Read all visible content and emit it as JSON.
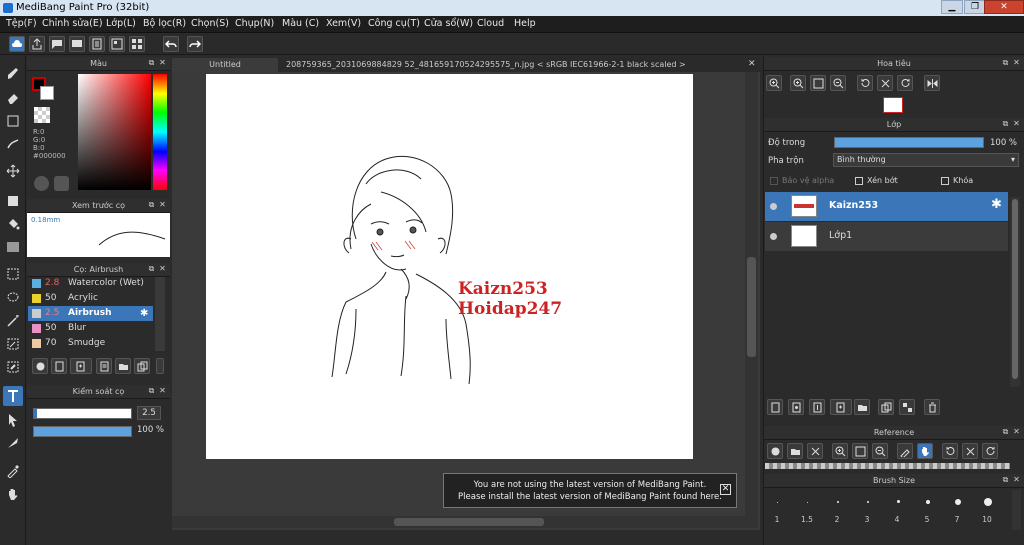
{
  "window": {
    "title": "MediBang Paint Pro (32bit)",
    "min": "▁",
    "max": "❐",
    "close": "✕"
  },
  "menu": [
    "Tệp(F)",
    "Chỉnh sửa(E)",
    "Lớp(L)",
    "Bộ lọc(R)",
    "Chọn(S)",
    "Chụp(N)",
    "Màu (C)",
    "Xem(V)",
    "Công cụ(T)",
    "Cửa sổ(W)",
    "Cloud",
    "Help"
  ],
  "color_panel": {
    "title": "Màu",
    "r": "R:0",
    "g": "G:0",
    "b": "B:0",
    "hex": "#000000"
  },
  "preview_panel": {
    "title": "Xem trước cọ",
    "size": "0.18mm"
  },
  "brush_panel": {
    "title": "Cọ: Airbrush",
    "items": [
      {
        "size": "2.8",
        "name": "Watercolor (Wet)",
        "color": "#5ab0e0"
      },
      {
        "size": "50",
        "name": "Acrylic",
        "color": "#e8d030"
      },
      {
        "size": "2.5",
        "name": "Airbrush",
        "color": "#cccccc"
      },
      {
        "size": "50",
        "name": "Blur",
        "color": "#e890c8"
      },
      {
        "size": "70",
        "name": "Smudge",
        "color": "#f0c8a0"
      }
    ]
  },
  "brush_control": {
    "title": "Kiểm soát cọ",
    "size": "2.5",
    "opacity": "100 %"
  },
  "tabs": [
    "Untitled",
    "208759365_2031069884829 52_481659170524295575_n.jpg < sRGB IEC61966-2-1 black scaled >"
  ],
  "canvas_text": {
    "line1": "Kaizn253",
    "line2": "Hoidap247"
  },
  "notice": {
    "line1": "You are not using the latest version of MediBang Paint.",
    "line2": "Please install the latest version of MediBang Paint found here."
  },
  "navigator": {
    "title": "Hoa tiêu"
  },
  "layer_panel": {
    "title": "Lớp",
    "opacity_label": "Độ trong",
    "opacity_value": "100 %",
    "blend_label": "Pha trộn",
    "blend_value": "Bình thường",
    "protect_alpha": "Bảo vệ alpha",
    "clipping": "Xén bớt",
    "lock": "Khóa",
    "layers": [
      "Kaizn253",
      "Lớp1"
    ]
  },
  "reference": {
    "title": "Reference"
  },
  "brush_size": {
    "title": "Brush Size",
    "sizes": [
      "1",
      "1.5",
      "2",
      "3",
      "4",
      "5",
      "7",
      "10"
    ]
  },
  "colors": {
    "accent": "#3a76b8",
    "panel": "#2b2b2b",
    "canvas_text": "#cc2222"
  }
}
